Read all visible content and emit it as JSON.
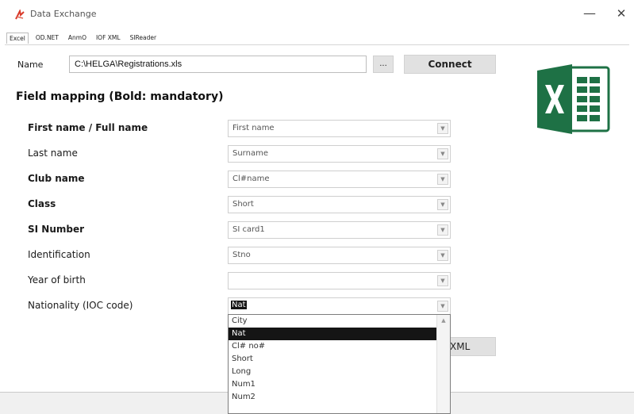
{
  "window": {
    "title": "Data Exchange",
    "minimize_glyph": "—",
    "close_glyph": "✕",
    "app_icon": "data-exchange-icon"
  },
  "tabs": [
    {
      "label": "Excel",
      "active": true
    },
    {
      "label": "OD.NET",
      "active": false
    },
    {
      "label": "AnmO",
      "active": false
    },
    {
      "label": "IOF XML",
      "active": false
    },
    {
      "label": "SIReader",
      "active": false
    }
  ],
  "file": {
    "label": "Name",
    "value": "C:\\HELGA\\Registrations.xls",
    "browse_label": "...",
    "connect_label": "Connect"
  },
  "mapping": {
    "title": "Field mapping (Bold: mandatory)",
    "rows": [
      {
        "label": "First name / Full name",
        "value": "First name"
      },
      {
        "label": "Last name",
        "value": "Surname"
      },
      {
        "label": "Club name",
        "value": "Cl#name"
      },
      {
        "label": "Class",
        "value": "Short"
      },
      {
        "label": "SI Number",
        "value": "SI card1"
      },
      {
        "label": "Identification",
        "value": "Stno"
      },
      {
        "label": "Year of birth",
        "value": ""
      },
      {
        "label": "Nationality (IOC code)",
        "value": "Nat"
      }
    ]
  },
  "dropdown": {
    "options": [
      "City",
      "Nat",
      "Cl# no#",
      "Short",
      "Long",
      "Num1",
      "Num2"
    ],
    "highlighted": "Nat"
  },
  "xml_button": {
    "label": "XML"
  },
  "colors": {
    "excel_green": "#1e7145",
    "excel_light": "#21a366",
    "selection": "#141414"
  }
}
